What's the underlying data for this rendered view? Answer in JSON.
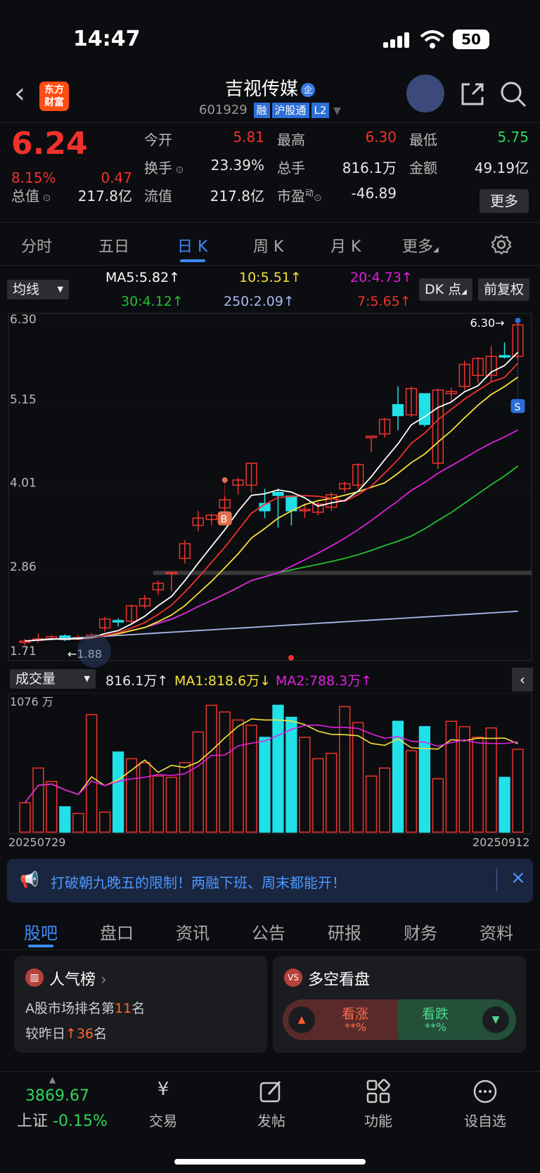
{
  "status": {
    "time": "14:47",
    "battery": "50"
  },
  "header": {
    "logo": "东方\n财富",
    "title": "吉视传媒",
    "qi_badge": "企",
    "code": "601929",
    "tags": [
      "融",
      "沪股通",
      "L2"
    ]
  },
  "quote": {
    "price": "6.24",
    "pct": "8.15%",
    "change": "0.47",
    "rows": [
      [
        {
          "l": "今开",
          "v": "5.81",
          "c": "#f0322d"
        },
        {
          "l": "最高",
          "v": "6.30",
          "c": "#f0322d"
        },
        {
          "l": "最低",
          "v": "5.75",
          "c": "#2fd65a"
        }
      ],
      [
        {
          "l": "换手",
          "v": "23.39%",
          "c": "#e8e8e8"
        },
        {
          "l": "总手",
          "v": "816.1万",
          "c": "#e8e8e8"
        },
        {
          "l": "金额",
          "v": "49.19亿",
          "c": "#e8e8e8"
        }
      ],
      [
        {
          "l": "流值",
          "v": "217.8亿",
          "c": "#e8e8e8"
        },
        {
          "l": "市盈",
          "v": "-46.89",
          "c": "#e8e8e8"
        }
      ]
    ],
    "total_label": "总值",
    "total_value": "217.8亿",
    "more": "更多"
  },
  "tabs": [
    "分时",
    "五日",
    "日 K",
    "周 K",
    "月 K",
    "更多"
  ],
  "indicator": {
    "select": "均线",
    "dk": "DK 点",
    "fq": "前复权",
    "ma": [
      {
        "t": "MA5:5.82↑",
        "c": "#ffffff"
      },
      {
        "t": "10:5.51↑",
        "c": "#f5e23a"
      },
      {
        "t": "20:4.73↑",
        "c": "#e020e0"
      },
      {
        "t": "30:4.12↑",
        "c": "#22c030"
      },
      {
        "t": "250:2.09↑",
        "c": "#aab8f0"
      },
      {
        "t": "7:5.65↑",
        "c": "#f0322d"
      }
    ]
  },
  "kchart": {
    "y_ticks": [
      "6.30",
      "5.15",
      "4.01",
      "2.86",
      "1.71"
    ],
    "high_label": "6.30→",
    "low_label": "←1.88",
    "b_marker": "B",
    "s_marker": "S"
  },
  "volume": {
    "select": "成交量",
    "value": "816.1万↑",
    "ma1": "MA1:818.6万↓",
    "ma2": "MA2:788.3万↑",
    "max": "1076 万",
    "start_date": "20250729",
    "end_date": "20250912"
  },
  "chart_data": {
    "type": "candlestick",
    "dates": [
      "20250729",
      "20250912"
    ],
    "ylim": [
      1.71,
      6.3
    ],
    "candles": [
      [
        1.9,
        1.92,
        1.86,
        1.95
      ],
      [
        1.93,
        1.95,
        1.9,
        2.02
      ],
      [
        1.95,
        1.98,
        1.93,
        2.0
      ],
      [
        1.99,
        1.94,
        1.92,
        2.01
      ],
      [
        1.95,
        1.97,
        1.93,
        2.0
      ],
      [
        1.98,
        2.0,
        1.95,
        2.03
      ],
      [
        2.1,
        2.22,
        2.05,
        2.25
      ],
      [
        2.2,
        2.18,
        2.12,
        2.23
      ],
      [
        2.19,
        2.4,
        2.15,
        2.42
      ],
      [
        2.4,
        2.5,
        2.36,
        2.55
      ],
      [
        2.62,
        2.71,
        2.55,
        2.75
      ],
      [
        2.85,
        2.86,
        2.6,
        2.86
      ],
      [
        3.05,
        3.25,
        2.98,
        3.3
      ],
      [
        3.5,
        3.6,
        3.42,
        3.7
      ],
      [
        3.58,
        3.64,
        3.5,
        3.66
      ],
      [
        3.74,
        3.85,
        3.55,
        3.9
      ],
      [
        4.05,
        4.12,
        3.92,
        4.15
      ],
      [
        4.05,
        4.35,
        3.95,
        4.35
      ],
      [
        3.8,
        3.7,
        3.6,
        4.0
      ],
      [
        3.95,
        3.91,
        3.47,
        4.0
      ],
      [
        3.9,
        3.7,
        3.5,
        3.9
      ],
      [
        3.7,
        3.72,
        3.6,
        3.8
      ],
      [
        3.68,
        3.79,
        3.64,
        3.82
      ],
      [
        3.75,
        3.92,
        3.7,
        3.95
      ],
      [
        4.0,
        4.07,
        3.95,
        4.1
      ],
      [
        4.05,
        4.33,
        4.0,
        4.35
      ],
      [
        4.7,
        4.72,
        4.5,
        4.7
      ],
      [
        4.75,
        4.95,
        4.7,
        4.97
      ],
      [
        5.15,
        5.0,
        4.8,
        5.4
      ],
      [
        5.01,
        5.37,
        4.98,
        5.4
      ],
      [
        5.3,
        4.88,
        4.85,
        5.3
      ],
      [
        4.35,
        5.35,
        4.27,
        5.37
      ],
      [
        5.3,
        5.33,
        5.2,
        5.38
      ],
      [
        5.4,
        5.7,
        5.35,
        5.75
      ],
      [
        5.55,
        5.78,
        5.45,
        5.8
      ],
      [
        5.55,
        5.81,
        5.45,
        5.95
      ],
      [
        5.82,
        5.8,
        5.78,
        6.0
      ],
      [
        5.81,
        6.24,
        5.75,
        6.3
      ]
    ],
    "volume_ratio": [
      0.22,
      0.48,
      0.38,
      0.19,
      0.14,
      0.88,
      0.15,
      0.6,
      0.55,
      0.52,
      0.42,
      0.41,
      0.52,
      0.75,
      0.95,
      0.9,
      0.84,
      0.8,
      0.71,
      0.95,
      0.86,
      0.71,
      0.55,
      0.59,
      0.94,
      0.82,
      0.42,
      0.48,
      0.83,
      0.61,
      0.79,
      0.4,
      0.83,
      0.79,
      0.71,
      0.78,
      0.41,
      0.62
    ]
  },
  "banner": {
    "text": "打破朝九晚五的限制！两融下班、周末都能开！"
  },
  "section_tabs": [
    "股吧",
    "盘口",
    "资讯",
    "公告",
    "研报",
    "财务",
    "资料"
  ],
  "rank_card": {
    "title": "人气榜",
    "line1a": "A股市场排名第",
    "rank": "11",
    "line1b": "名",
    "line2a": "较昨日",
    "up": "36",
    "line2b": "名"
  },
  "vs_card": {
    "title": "多空看盘",
    "bull": "看涨",
    "bear": "看跌",
    "hidden": "**%"
  },
  "bottom": {
    "index_value": "3869.67",
    "index_name": "上证",
    "index_pct": "-0.15%",
    "items": [
      "交易",
      "发帖",
      "功能",
      "设自选"
    ]
  }
}
